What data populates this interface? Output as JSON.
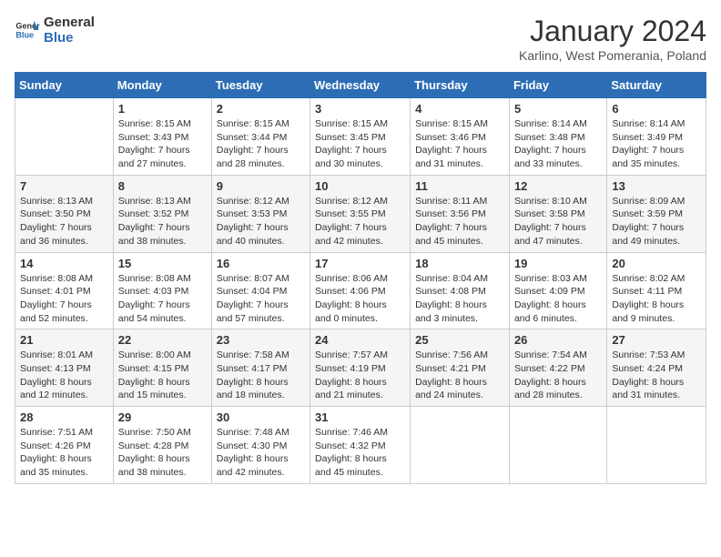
{
  "header": {
    "logo_line1": "General",
    "logo_line2": "Blue",
    "month": "January 2024",
    "location": "Karlino, West Pomerania, Poland"
  },
  "days_of_week": [
    "Sunday",
    "Monday",
    "Tuesday",
    "Wednesday",
    "Thursday",
    "Friday",
    "Saturday"
  ],
  "weeks": [
    [
      {
        "day": "",
        "detail": ""
      },
      {
        "day": "1",
        "detail": "Sunrise: 8:15 AM\nSunset: 3:43 PM\nDaylight: 7 hours\nand 27 minutes."
      },
      {
        "day": "2",
        "detail": "Sunrise: 8:15 AM\nSunset: 3:44 PM\nDaylight: 7 hours\nand 28 minutes."
      },
      {
        "day": "3",
        "detail": "Sunrise: 8:15 AM\nSunset: 3:45 PM\nDaylight: 7 hours\nand 30 minutes."
      },
      {
        "day": "4",
        "detail": "Sunrise: 8:15 AM\nSunset: 3:46 PM\nDaylight: 7 hours\nand 31 minutes."
      },
      {
        "day": "5",
        "detail": "Sunrise: 8:14 AM\nSunset: 3:48 PM\nDaylight: 7 hours\nand 33 minutes."
      },
      {
        "day": "6",
        "detail": "Sunrise: 8:14 AM\nSunset: 3:49 PM\nDaylight: 7 hours\nand 35 minutes."
      }
    ],
    [
      {
        "day": "7",
        "detail": "Sunrise: 8:13 AM\nSunset: 3:50 PM\nDaylight: 7 hours\nand 36 minutes."
      },
      {
        "day": "8",
        "detail": "Sunrise: 8:13 AM\nSunset: 3:52 PM\nDaylight: 7 hours\nand 38 minutes."
      },
      {
        "day": "9",
        "detail": "Sunrise: 8:12 AM\nSunset: 3:53 PM\nDaylight: 7 hours\nand 40 minutes."
      },
      {
        "day": "10",
        "detail": "Sunrise: 8:12 AM\nSunset: 3:55 PM\nDaylight: 7 hours\nand 42 minutes."
      },
      {
        "day": "11",
        "detail": "Sunrise: 8:11 AM\nSunset: 3:56 PM\nDaylight: 7 hours\nand 45 minutes."
      },
      {
        "day": "12",
        "detail": "Sunrise: 8:10 AM\nSunset: 3:58 PM\nDaylight: 7 hours\nand 47 minutes."
      },
      {
        "day": "13",
        "detail": "Sunrise: 8:09 AM\nSunset: 3:59 PM\nDaylight: 7 hours\nand 49 minutes."
      }
    ],
    [
      {
        "day": "14",
        "detail": "Sunrise: 8:08 AM\nSunset: 4:01 PM\nDaylight: 7 hours\nand 52 minutes."
      },
      {
        "day": "15",
        "detail": "Sunrise: 8:08 AM\nSunset: 4:03 PM\nDaylight: 7 hours\nand 54 minutes."
      },
      {
        "day": "16",
        "detail": "Sunrise: 8:07 AM\nSunset: 4:04 PM\nDaylight: 7 hours\nand 57 minutes."
      },
      {
        "day": "17",
        "detail": "Sunrise: 8:06 AM\nSunset: 4:06 PM\nDaylight: 8 hours\nand 0 minutes."
      },
      {
        "day": "18",
        "detail": "Sunrise: 8:04 AM\nSunset: 4:08 PM\nDaylight: 8 hours\nand 3 minutes."
      },
      {
        "day": "19",
        "detail": "Sunrise: 8:03 AM\nSunset: 4:09 PM\nDaylight: 8 hours\nand 6 minutes."
      },
      {
        "day": "20",
        "detail": "Sunrise: 8:02 AM\nSunset: 4:11 PM\nDaylight: 8 hours\nand 9 minutes."
      }
    ],
    [
      {
        "day": "21",
        "detail": "Sunrise: 8:01 AM\nSunset: 4:13 PM\nDaylight: 8 hours\nand 12 minutes."
      },
      {
        "day": "22",
        "detail": "Sunrise: 8:00 AM\nSunset: 4:15 PM\nDaylight: 8 hours\nand 15 minutes."
      },
      {
        "day": "23",
        "detail": "Sunrise: 7:58 AM\nSunset: 4:17 PM\nDaylight: 8 hours\nand 18 minutes."
      },
      {
        "day": "24",
        "detail": "Sunrise: 7:57 AM\nSunset: 4:19 PM\nDaylight: 8 hours\nand 21 minutes."
      },
      {
        "day": "25",
        "detail": "Sunrise: 7:56 AM\nSunset: 4:21 PM\nDaylight: 8 hours\nand 24 minutes."
      },
      {
        "day": "26",
        "detail": "Sunrise: 7:54 AM\nSunset: 4:22 PM\nDaylight: 8 hours\nand 28 minutes."
      },
      {
        "day": "27",
        "detail": "Sunrise: 7:53 AM\nSunset: 4:24 PM\nDaylight: 8 hours\nand 31 minutes."
      }
    ],
    [
      {
        "day": "28",
        "detail": "Sunrise: 7:51 AM\nSunset: 4:26 PM\nDaylight: 8 hours\nand 35 minutes."
      },
      {
        "day": "29",
        "detail": "Sunrise: 7:50 AM\nSunset: 4:28 PM\nDaylight: 8 hours\nand 38 minutes."
      },
      {
        "day": "30",
        "detail": "Sunrise: 7:48 AM\nSunset: 4:30 PM\nDaylight: 8 hours\nand 42 minutes."
      },
      {
        "day": "31",
        "detail": "Sunrise: 7:46 AM\nSunset: 4:32 PM\nDaylight: 8 hours\nand 45 minutes."
      },
      {
        "day": "",
        "detail": ""
      },
      {
        "day": "",
        "detail": ""
      },
      {
        "day": "",
        "detail": ""
      }
    ]
  ]
}
